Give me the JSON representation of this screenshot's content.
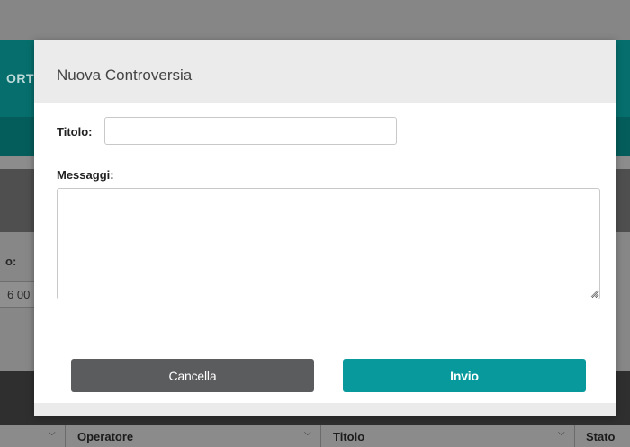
{
  "background": {
    "header_text": "ORT",
    "left_label": "o:",
    "left_value": "6 00",
    "table_columns": [
      "Operatore",
      "Titolo",
      "Stato"
    ]
  },
  "modal": {
    "title": "Nuova Controversia",
    "fields": {
      "titolo_label": "Titolo:",
      "titolo_value": "",
      "messaggi_label": "Messaggi:",
      "messaggi_value": ""
    },
    "buttons": {
      "cancel_label": "Cancella",
      "send_label": "Invio"
    }
  },
  "colors": {
    "accent": "#07999b",
    "cancel": "#5b5c5e",
    "header_teal": "#066f6d"
  },
  "icons": {
    "column_sort": "chevron-down-icon",
    "textarea_resize": "resize-grip-icon"
  }
}
